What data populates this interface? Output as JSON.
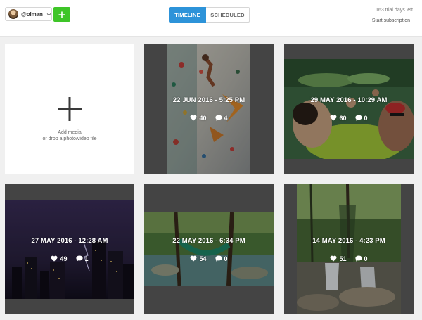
{
  "header": {
    "account_name": "@olman",
    "tabs": [
      {
        "label": "TIMELINE",
        "active": true
      },
      {
        "label": "SCHEDULED",
        "active": false
      }
    ],
    "trial_text": "163 trial days left",
    "subscription_link": "Start subscription"
  },
  "add_media": {
    "line1": "Add media",
    "line2": "or drop a photo/video file"
  },
  "posts": [
    {
      "date": "22 JUN 2016 - 5:25 PM",
      "likes": "40",
      "comments": "4"
    },
    {
      "date": "29 MAY 2016 - 10:29 AM",
      "likes": "60",
      "comments": "0"
    },
    {
      "date": "27 MAY 2016 - 12:28 AM",
      "likes": "49",
      "comments": "1"
    },
    {
      "date": "22 MAY 2016 - 6:34 PM",
      "likes": "54",
      "comments": "0"
    },
    {
      "date": "14 MAY 2016 - 4:23 PM",
      "likes": "51",
      "comments": "0"
    }
  ],
  "colors": {
    "accent_blue": "#2d93d9",
    "add_green": "#3ec528",
    "tile_bg": "#5f5f5f"
  }
}
